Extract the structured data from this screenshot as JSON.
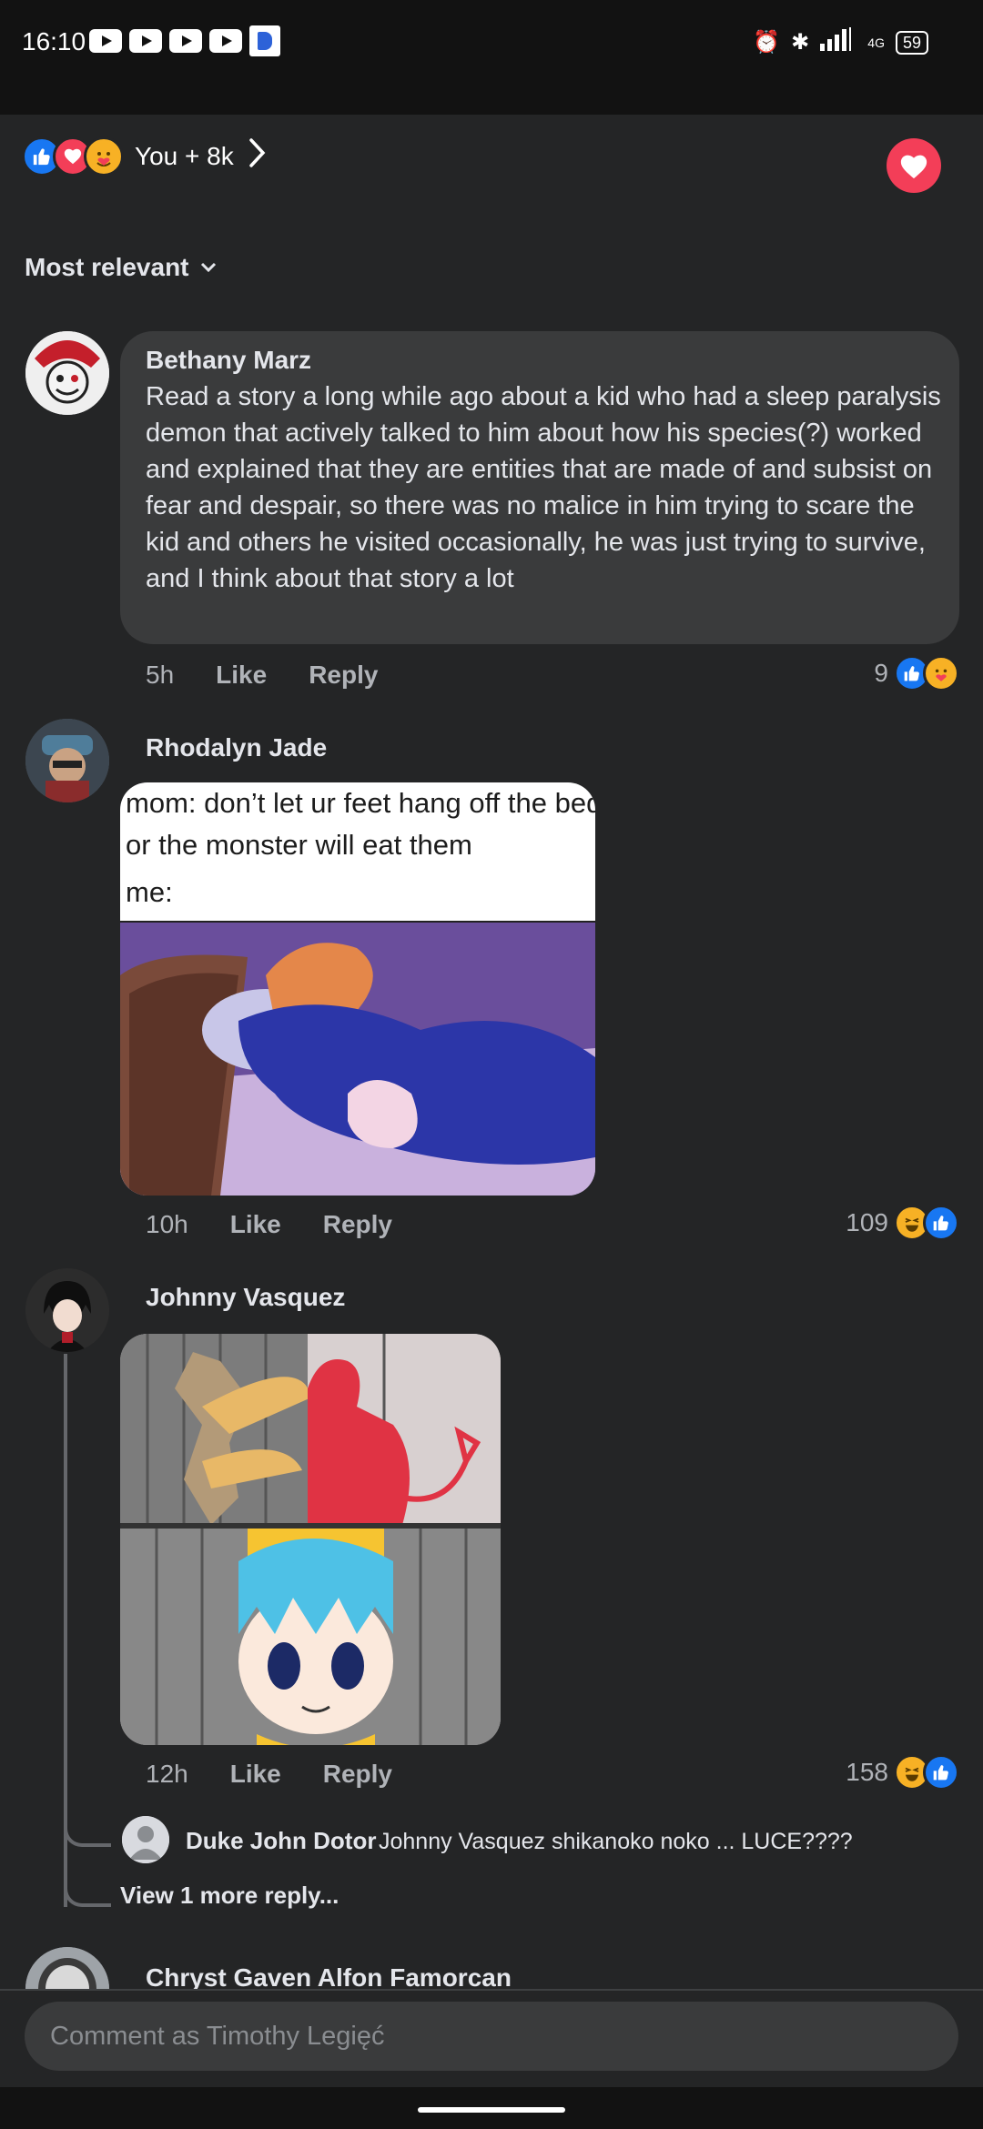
{
  "status_bar": {
    "time": "16:10",
    "network": "4G",
    "battery": "59"
  },
  "reactions_summary": {
    "text": "You + 8k"
  },
  "sort": {
    "label": "Most relevant"
  },
  "comments": [
    {
      "author": "Bethany Marz",
      "text": "Read a story a long while ago about a kid who had a sleep paralysis demon that actively talked to him about how his species(?) worked and explained that they are entities that are made of and subsist on fear and despair, so there was no malice in him trying to scare the kid and others he visited occasionally, he was just trying to survive, and I think about that story a lot",
      "time": "5h",
      "like_label": "Like",
      "reply_label": "Reply",
      "reaction_count": "9"
    },
    {
      "author": "Rhodalyn Jade",
      "meme_lines": [
        "mom: don’t let ur feet hang off the bed",
        "or the monster will eat them",
        "me:"
      ],
      "time": "10h",
      "like_label": "Like",
      "reply_label": "Reply",
      "reaction_count": "109"
    },
    {
      "author": "Johnny Vasquez",
      "time": "12h",
      "like_label": "Like",
      "reply_label": "Reply",
      "reaction_count": "158",
      "reply": {
        "author": "Duke John Dotor",
        "text": "Johnny Vasquez shikanoko noko ... LUCE????"
      },
      "view_more": "View 1 more reply..."
    },
    {
      "author": "Chryst Gaven Alfon Famorcan"
    }
  ],
  "composer": {
    "placeholder": "Comment as Timothy Legięć"
  }
}
